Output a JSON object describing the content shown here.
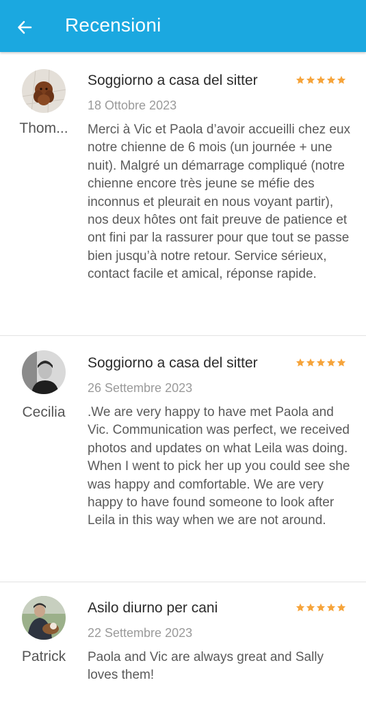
{
  "header": {
    "title": "Recensioni",
    "back_icon": "arrow-left-icon",
    "background_color": "#1ba8e0"
  },
  "reviews": [
    {
      "reviewer": "Thom...",
      "service": "Soggiorno a casa del sitter",
      "rating": 5,
      "date": "18 Ottobre 2023",
      "text": "Merci à Vic et Paola d’avoir accueilli chez eux notre chienne de 6 mois (un journée + une nuit). Malgré un démarrage compliqué (notre chienne encore très jeune se méfie des inconnus et pleurait en nous voyant partir), nos deux hôtes ont fait preuve de patience et ont fini par la rassurer pour que tout se passe bien jusqu’à notre retour. Service sérieux, contact facile et amical, réponse rapide."
    },
    {
      "reviewer": "Cecilia",
      "service": "Soggiorno a casa del sitter",
      "rating": 5,
      "date": "26 Settembre 2023",
      "text": ".We are very happy to have met Paola and Vic. Communication was perfect, we received photos and updates on what Leila was doing. When I went to pick her up you could see she was happy and comfortable. We are very happy to have found someone to look after Leila in this way when we are not around."
    },
    {
      "reviewer": "Patrick",
      "service": "Asilo diurno per cani",
      "rating": 5,
      "date": "22 Settembre 2023",
      "text": "Paola and Vic are always great and Sally loves them!"
    }
  ],
  "colors": {
    "star": "#f6a43b",
    "divider": "#e3e3e3"
  }
}
